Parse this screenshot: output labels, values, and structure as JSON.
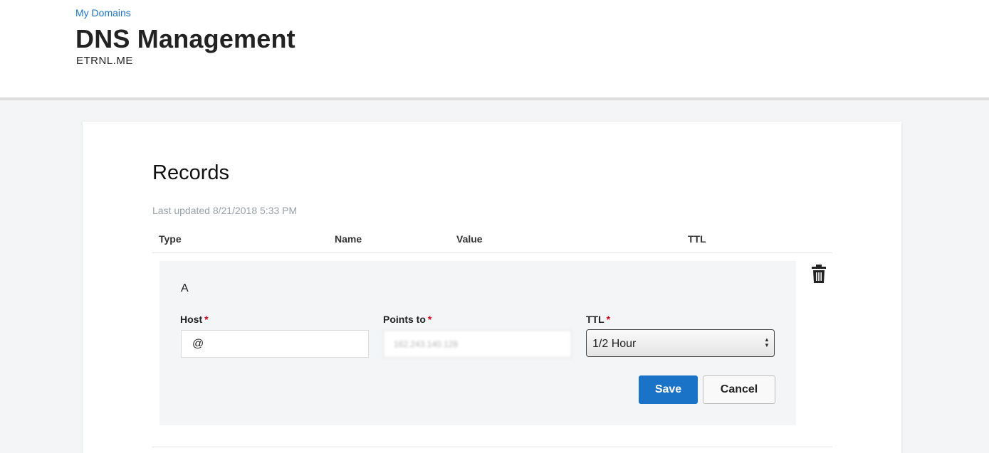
{
  "header": {
    "breadcrumb": "My Domains",
    "title": "DNS Management",
    "domain": "ETRNL.ME"
  },
  "records": {
    "title": "Records",
    "last_updated": "Last updated 8/21/2018 5:33 PM",
    "columns": [
      "Type",
      "Name",
      "Value",
      "TTL"
    ],
    "editing_record": {
      "type": "A",
      "host_label": "Host",
      "host_value": "@",
      "points_to_label": "Points to",
      "points_to_value": "162.243.140.128",
      "ttl_label": "TTL",
      "ttl_value": "1/2 Hour",
      "required_marker": "*",
      "save_label": "Save",
      "cancel_label": "Cancel"
    }
  },
  "icons": {
    "delete": "trash-icon",
    "select": "updown-arrows-icon"
  },
  "colors": {
    "link": "#1a73c7",
    "primary_button": "#1a73c7",
    "required": "#d0021b"
  }
}
